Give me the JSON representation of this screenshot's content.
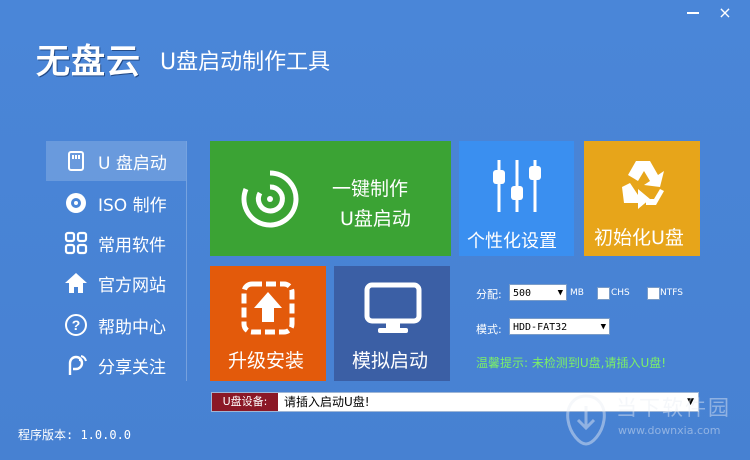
{
  "window": {
    "minimize_icon": "minimize-icon",
    "close_label": "×"
  },
  "header": {
    "logo": "无盘云",
    "subtitle": "U盘启动制作工具"
  },
  "sidebar": {
    "items": [
      {
        "label": "U 盘启动",
        "icon": "usb-drive-icon"
      },
      {
        "label": "ISO 制作",
        "icon": "disc-icon"
      },
      {
        "label": "常用软件",
        "icon": "apps-grid-icon"
      },
      {
        "label": "官方网站",
        "icon": "home-icon"
      },
      {
        "label": "帮助中心",
        "icon": "help-icon"
      },
      {
        "label": "分享关注",
        "icon": "share-icon"
      }
    ]
  },
  "tiles": {
    "make_line1": "一键制作",
    "make_line2": "U盘启动",
    "personalize": "个性化设置",
    "init": "初始化U盘",
    "upgrade": "升级安装",
    "simulate": "模拟启动"
  },
  "settings": {
    "alloc_label": "分配:",
    "alloc_value": "500",
    "alloc_unit": "MB",
    "chs_label": "CHS",
    "ntfs_label": "NTFS",
    "mode_label": "模式:",
    "mode_value": "HDD-FAT32",
    "hint": "温馨提示: 未检测到U盘,请插入U盘!"
  },
  "device": {
    "tag": "U盘设备:",
    "text": "请插入启动U盘!"
  },
  "footer": {
    "version": "程序版本: 1.0.0.0"
  },
  "watermark": {
    "text": "当下软件园",
    "url": "www.downxia.com"
  },
  "colors": {
    "background": "#4a86d8",
    "green_tile": "#3ba334",
    "blue_tile": "#3a8ff0",
    "orange_tile": "#e7a51a",
    "red_tile": "#e35a0b",
    "navy_tile": "#3b5fa5",
    "device_tag": "#8b1826",
    "hint_text": "#7cf067"
  }
}
